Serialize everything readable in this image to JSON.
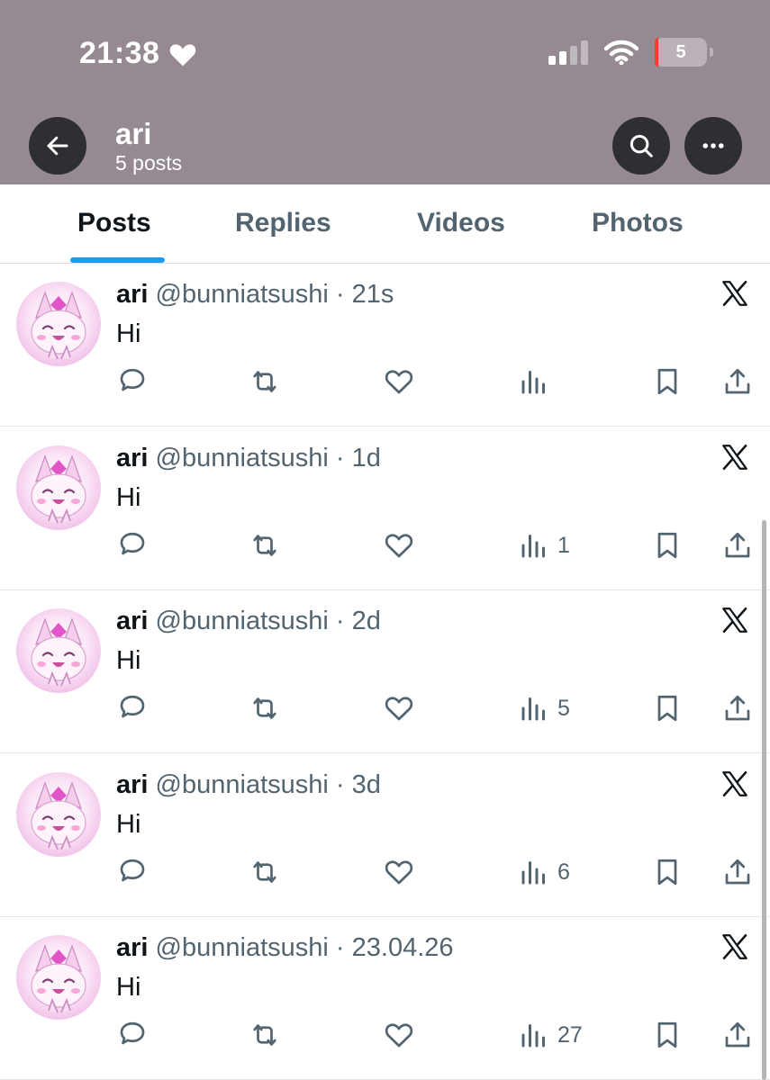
{
  "status_bar": {
    "time": "21:38",
    "battery_level": "5",
    "icons": [
      "heart-icon",
      "signal-icon",
      "wifi-icon",
      "battery-icon"
    ]
  },
  "header": {
    "name": "ari",
    "post_count": "5 posts",
    "background_color": "#958992"
  },
  "tabs": [
    {
      "label": "Posts",
      "active": true
    },
    {
      "label": "Replies",
      "active": false
    },
    {
      "label": "Videos",
      "active": false
    },
    {
      "label": "Photos",
      "active": false
    }
  ],
  "posts": [
    {
      "name": "ari",
      "handle": "@bunniatsushi",
      "separator": "·",
      "time": "21s",
      "text": "Hi",
      "views": ""
    },
    {
      "name": "ari",
      "handle": "@bunniatsushi",
      "separator": "·",
      "time": "1d",
      "text": "Hi",
      "views": "1"
    },
    {
      "name": "ari",
      "handle": "@bunniatsushi",
      "separator": "·",
      "time": "2d",
      "text": "Hi",
      "views": "5"
    },
    {
      "name": "ari",
      "handle": "@bunniatsushi",
      "separator": "·",
      "time": "3d",
      "text": "Hi",
      "views": "6"
    },
    {
      "name": "ari",
      "handle": "@bunniatsushi",
      "separator": "·",
      "time": "23.04.26",
      "text": "Hi",
      "views": "27"
    }
  ],
  "colors": {
    "accent": "#1d9bf0",
    "text_primary": "#0f1419",
    "text_secondary": "#536471"
  }
}
